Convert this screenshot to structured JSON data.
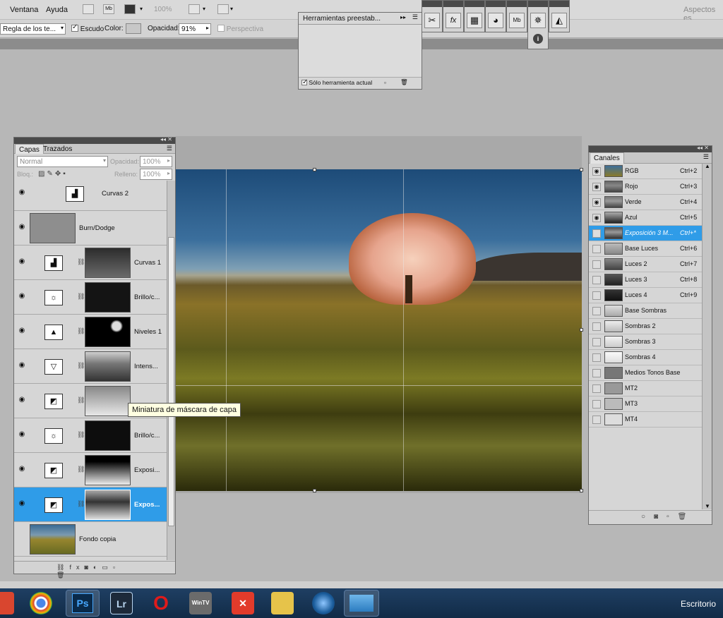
{
  "menu": {
    "items": [
      "Ventana",
      "Ayuda"
    ],
    "zoom": "100%",
    "workspace": "Aspectos es"
  },
  "options": {
    "sample": "Regla de los te...",
    "escudo_label": "Escudo",
    "color_label": "Color:",
    "opacity_label": "Opacidad:",
    "opacity_value": "91%",
    "perspective_label": "Perspectiva"
  },
  "presets": {
    "title": "Herramientas preestab...",
    "only_current": "Sólo herramienta actual"
  },
  "dock_icons": [
    "tools-icon",
    "fx-icon",
    "grid-icon",
    "palette-icon",
    "mb-icon",
    "compass-icon",
    "histogram-icon",
    "info-icon"
  ],
  "layers": {
    "tabs": [
      "Capas",
      "Trazados"
    ],
    "blend_mode": "Normal",
    "opacity_label": "Opacidad:",
    "opacity_value": "100%",
    "lock_label": "Bloq.:",
    "fill_label": "Relleno:",
    "fill_value": "100%",
    "rows": [
      {
        "name": "Curvas 2",
        "icon": "curves-icon"
      },
      {
        "name": "Burn/Dodge",
        "icon": "gray-thumb"
      },
      {
        "name": "Curvas 1",
        "icon": "curves-icon"
      },
      {
        "name": "Brillo/c...",
        "icon": "brightness-icon"
      },
      {
        "name": "Niveles 1",
        "icon": "levels-icon"
      },
      {
        "name": "Intens...",
        "icon": "vibrance-icon"
      },
      {
        "name": "",
        "icon": "exposure-icon"
      },
      {
        "name": "Brillo/c...",
        "icon": "brightness-icon"
      },
      {
        "name": "Exposi...",
        "icon": "exposure-icon"
      },
      {
        "name": "Expos...",
        "icon": "exposure-icon"
      },
      {
        "name": "Fondo copia",
        "icon": "photo-thumb"
      }
    ]
  },
  "tooltip": "Miniatura de máscara de capa",
  "channels": {
    "title": "Canales",
    "rows": [
      {
        "name": "RGB",
        "key": "Ctrl+2"
      },
      {
        "name": "Rojo",
        "key": "Ctrl+3"
      },
      {
        "name": "Verde",
        "key": "Ctrl+4"
      },
      {
        "name": "Azul",
        "key": "Ctrl+5"
      },
      {
        "name": "Exposición 3 M...",
        "key": "Ctrl+*"
      },
      {
        "name": "Base Luces",
        "key": "Ctrl+6"
      },
      {
        "name": "Luces 2",
        "key": "Ctrl+7"
      },
      {
        "name": "Luces 3",
        "key": "Ctrl+8"
      },
      {
        "name": "Luces 4",
        "key": "Ctrl+9"
      },
      {
        "name": "Base Sombras",
        "key": ""
      },
      {
        "name": "Sombras 2",
        "key": ""
      },
      {
        "name": "Sombras 3",
        "key": ""
      },
      {
        "name": "Sombras 4",
        "key": ""
      },
      {
        "name": "Medios Tonos Base",
        "key": ""
      },
      {
        "name": "MT2",
        "key": ""
      },
      {
        "name": "MT3",
        "key": ""
      },
      {
        "name": "MT4",
        "key": ""
      }
    ]
  },
  "taskbar": {
    "apps": [
      "Ps",
      "Lr",
      "WinTV"
    ],
    "desktop_label": "Escritorio"
  }
}
